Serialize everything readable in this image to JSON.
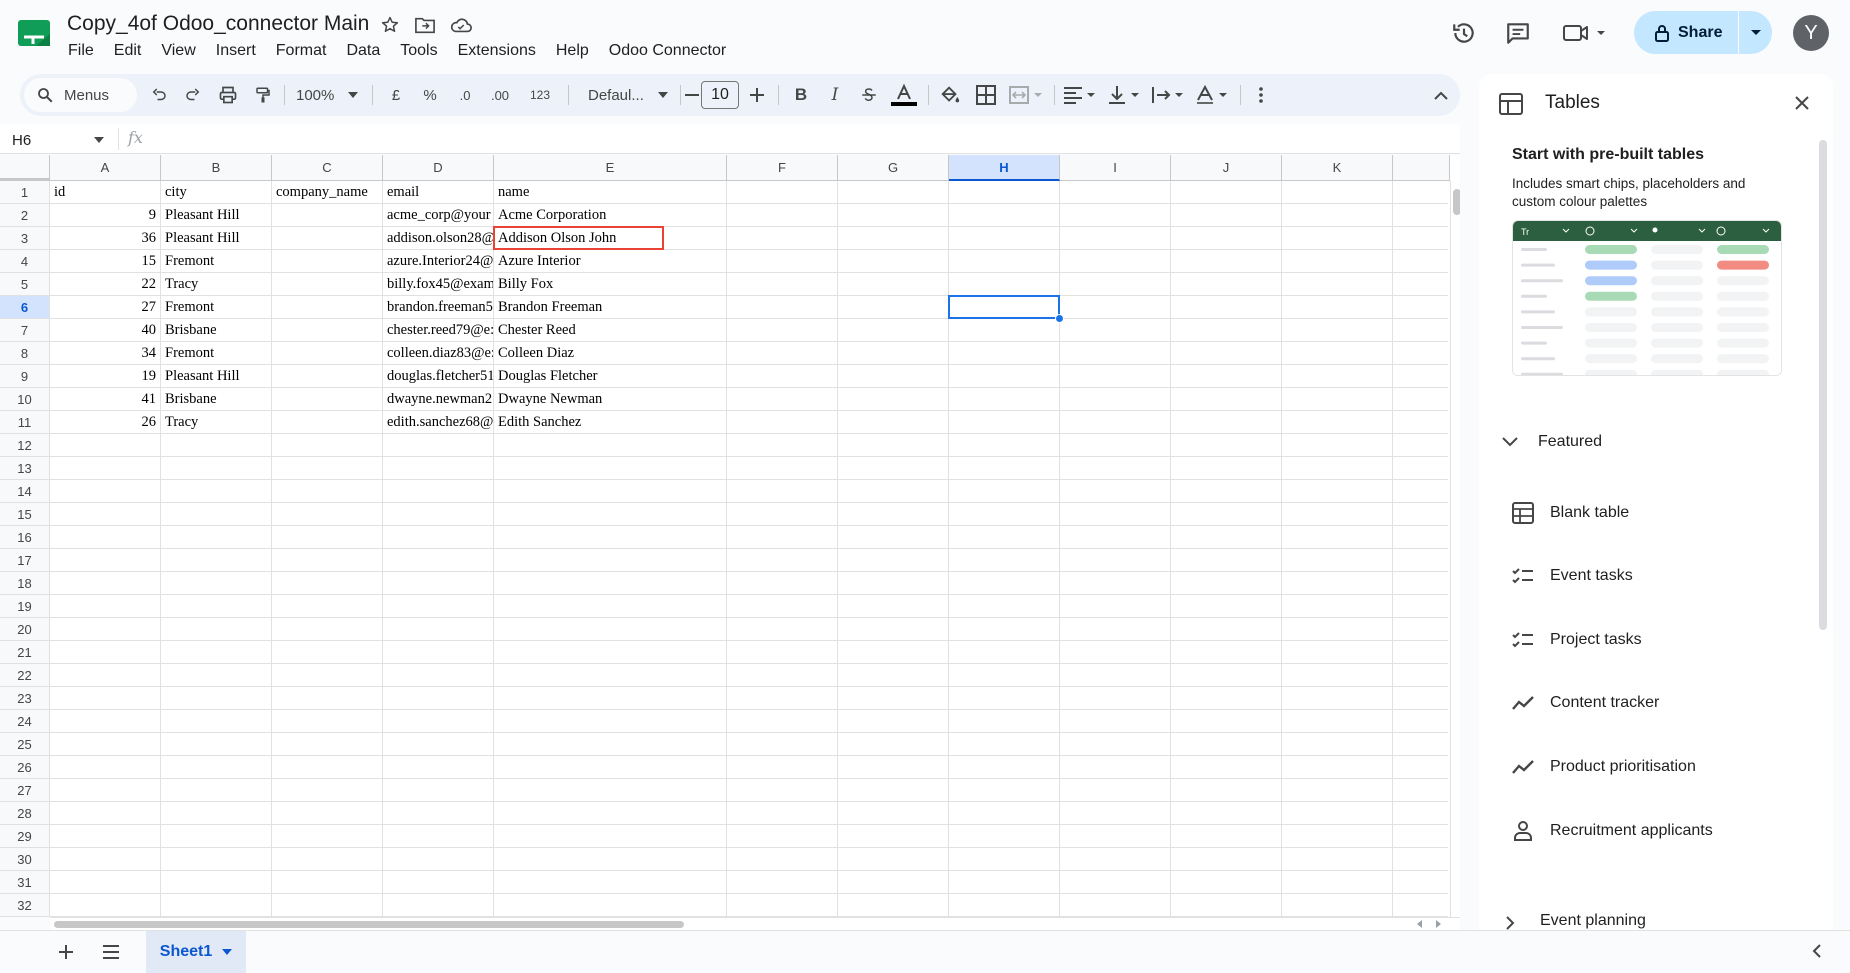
{
  "header": {
    "doc_title": "Copy_4of Odoo_connector Main",
    "menu": [
      "File",
      "Edit",
      "View",
      "Insert",
      "Format",
      "Data",
      "Tools",
      "Extensions",
      "Help",
      "Odoo Connector"
    ],
    "share_label": "Share",
    "avatar_letter": "Y"
  },
  "toolbar": {
    "search_label": "Menus",
    "zoom": "100%",
    "currency": "£",
    "percent": "%",
    "dec_decrease": ".0",
    "dec_increase": ".00",
    "number_format": "123",
    "font_name": "Defaul...",
    "font_size": "10"
  },
  "formula_bar": {
    "name_box": "H6",
    "fx": "fx"
  },
  "grid": {
    "columns": [
      "A",
      "B",
      "C",
      "D",
      "E",
      "F",
      "G",
      "H",
      "I",
      "J",
      "K"
    ],
    "selected_column": "H",
    "selected_row": "6",
    "rows": [
      "1",
      "2",
      "3",
      "4",
      "5",
      "6",
      "7",
      "8",
      "9",
      "10",
      "11",
      "12",
      "13",
      "14",
      "15",
      "16",
      "17",
      "18",
      "19",
      "20",
      "21",
      "22",
      "23",
      "24",
      "25",
      "26",
      "27",
      "28",
      "29",
      "30",
      "31",
      "32"
    ],
    "headers": [
      "id",
      "city",
      "company_name",
      "email",
      "name"
    ],
    "data": [
      {
        "id": "9",
        "city": "Pleasant Hill",
        "company_name": "",
        "email": "acme_corp@your",
        "name": "Acme Corporation"
      },
      {
        "id": "36",
        "city": "Pleasant Hill",
        "company_name": "",
        "email": "addison.olson28@",
        "name": "Addison Olson John"
      },
      {
        "id": "15",
        "city": "Fremont",
        "company_name": "",
        "email": "azure.Interior24@",
        "name": "Azure Interior"
      },
      {
        "id": "22",
        "city": "Tracy",
        "company_name": "",
        "email": "billy.fox45@exam",
        "name": "Billy Fox"
      },
      {
        "id": "27",
        "city": "Fremont",
        "company_name": "",
        "email": "brandon.freeman5",
        "name": "Brandon Freeman"
      },
      {
        "id": "40",
        "city": "Brisbane",
        "company_name": "",
        "email": "chester.reed79@e:",
        "name": "Chester Reed"
      },
      {
        "id": "34",
        "city": "Fremont",
        "company_name": "",
        "email": "colleen.diaz83@e:",
        "name": "Colleen Diaz"
      },
      {
        "id": "19",
        "city": "Pleasant Hill",
        "company_name": "",
        "email": "douglas.fletcher51",
        "name": "Douglas Fletcher"
      },
      {
        "id": "41",
        "city": "Brisbane",
        "company_name": "",
        "email": "dwayne.newman2",
        "name": "Dwayne Newman"
      },
      {
        "id": "26",
        "city": "Tracy",
        "company_name": "",
        "email": "edith.sanchez68@",
        "name": "Edith Sanchez"
      }
    ]
  },
  "sheets": {
    "active": "Sheet1"
  },
  "side_panel": {
    "title": "Tables",
    "heading": "Start with pre-built tables",
    "description": "Includes smart chips, placeholders and custom colour palettes",
    "featured_label": "Featured",
    "items": [
      {
        "label": "Blank table",
        "icon": "table-icon"
      },
      {
        "label": "Event tasks",
        "icon": "checklist-icon"
      },
      {
        "label": "Project tasks",
        "icon": "checklist-icon"
      },
      {
        "label": "Content tracker",
        "icon": "trend-icon"
      },
      {
        "label": "Product prioritisation",
        "icon": "trend-icon"
      },
      {
        "label": "Recruitment applicants",
        "icon": "person-icon"
      }
    ],
    "event_planning_label": "Event planning"
  },
  "colors": {
    "accent": "#1a73e8",
    "share_bg": "#c2e7ff",
    "highlight_red": "#ea4335",
    "sheets_green": "#0f9d58"
  }
}
